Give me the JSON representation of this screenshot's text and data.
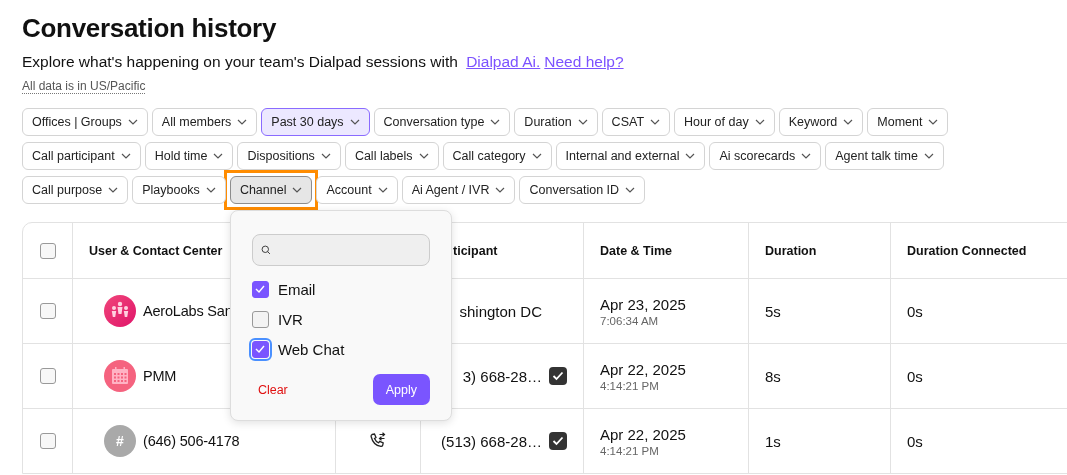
{
  "title": "Conversation history",
  "subtitle": {
    "text": "Explore what's happening on your team's Dialpad sessions with",
    "links": [
      "Dialpad Ai.",
      "Need help?"
    ]
  },
  "timezone_note": "All data is in US/Pacific",
  "filter_rows": [
    {
      "filters": [
        {
          "label": "Offices | Groups",
          "active": false
        },
        {
          "label": "All members",
          "active": false
        },
        {
          "label": "Past 30 days",
          "active": true
        },
        {
          "label": "Conversation type",
          "active": false
        },
        {
          "label": "Duration",
          "active": false
        },
        {
          "label": "CSAT",
          "active": false
        },
        {
          "label": "Hour of day",
          "active": false
        },
        {
          "label": "Keyword",
          "active": false
        },
        {
          "label": "Moment",
          "active": false
        }
      ]
    },
    {
      "filters": [
        {
          "label": "Call participant",
          "active": false
        },
        {
          "label": "Hold time",
          "active": false
        },
        {
          "label": "Dispositions",
          "active": false
        },
        {
          "label": "Call labels",
          "active": false
        },
        {
          "label": "Call category",
          "active": false
        },
        {
          "label": "Internal and external",
          "active": false
        },
        {
          "label": "Ai scorecards",
          "active": false
        },
        {
          "label": "Agent talk time",
          "active": false
        }
      ]
    },
    {
      "filters": [
        {
          "label": "Call purpose",
          "active": false
        },
        {
          "label": "Playbooks",
          "active": false
        },
        {
          "label": "Channel",
          "active": false,
          "open": true,
          "highlighted": true
        },
        {
          "label": "Account",
          "active": false
        },
        {
          "label": "Ai Agent / IVR",
          "active": false
        },
        {
          "label": "Conversation ID",
          "active": false
        }
      ]
    }
  ],
  "channel_menu": {
    "options": [
      {
        "label": "Email",
        "checked": true,
        "focused": false
      },
      {
        "label": "IVR",
        "checked": false,
        "focused": false
      },
      {
        "label": "Web Chat",
        "checked": true,
        "focused": true
      }
    ],
    "clear": "Clear",
    "apply": "Apply"
  },
  "table": {
    "header_checked": false,
    "columns": [
      "User & Contact Center",
      "ticipant",
      "Date & Time",
      "Duration",
      "Duration Connected"
    ],
    "rows": [
      {
        "checked": false,
        "avatar": {
          "kind": "group"
        },
        "user": "AeroLabs San",
        "participant": "shington DC",
        "verified": false,
        "date": "Apr 23, 2025",
        "time": "7:06:34 AM",
        "duration": "5s",
        "duration_connected": "0s"
      },
      {
        "checked": false,
        "avatar": {
          "kind": "calendar"
        },
        "user": "PMM",
        "participant": "3) 668-28…",
        "verified": true,
        "date": "Apr 22, 2025",
        "time": "4:14:21 PM",
        "duration": "8s",
        "duration_connected": "0s"
      },
      {
        "checked": false,
        "avatar": {
          "kind": "number",
          "text": "#"
        },
        "user": "(646) 506-4178",
        "call_icon": true,
        "participant": "(513) 668-28…",
        "verified": true,
        "date": "Apr 22, 2025",
        "time": "4:14:21 PM",
        "duration": "1s",
        "duration_connected": "0s"
      }
    ]
  }
}
